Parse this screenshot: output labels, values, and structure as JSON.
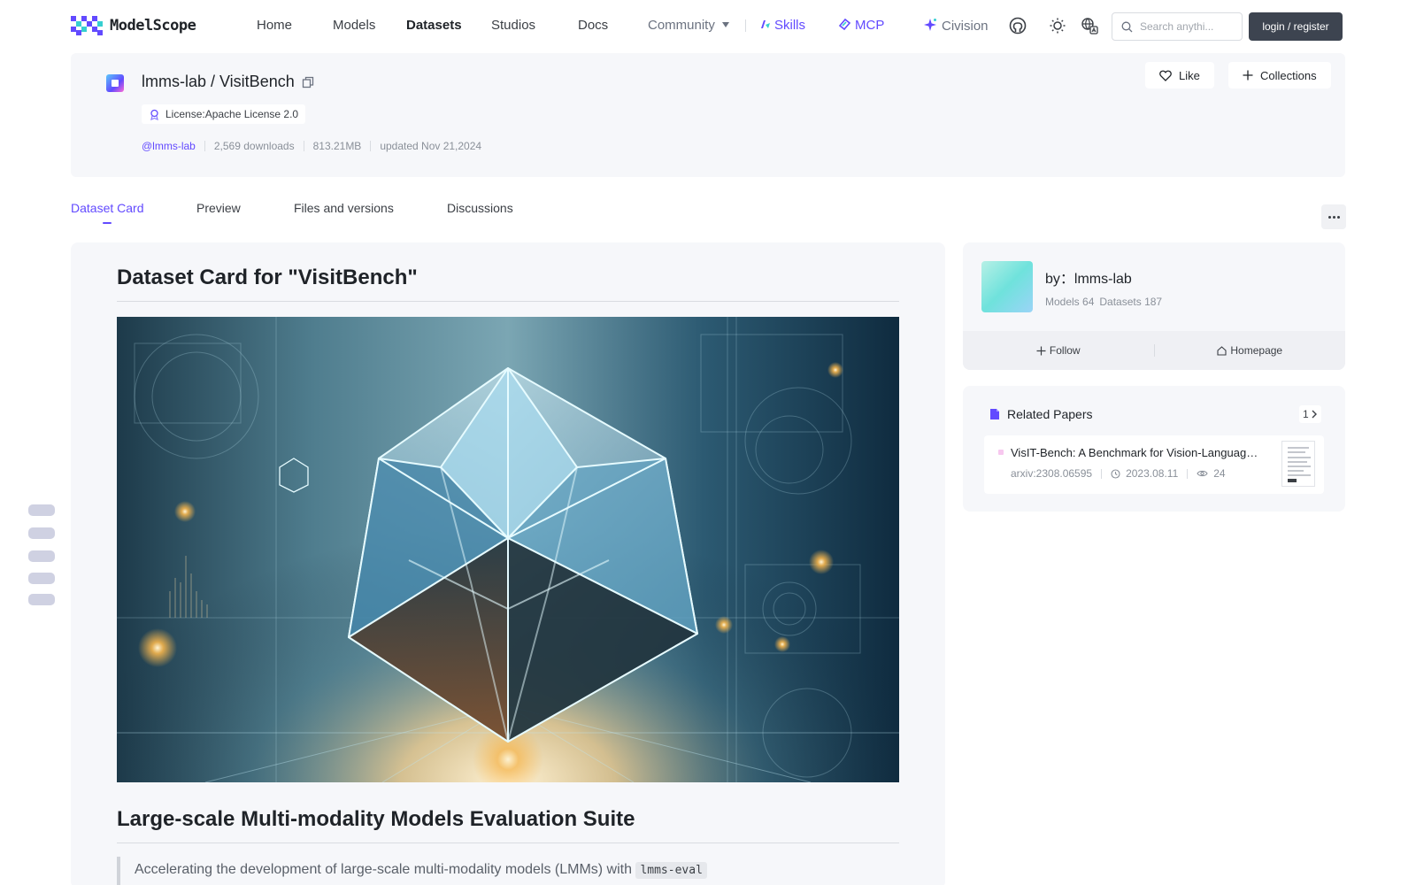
{
  "nav": {
    "logo_text": "ModelScope",
    "items": [
      "Home",
      "Models",
      "Datasets",
      "Studios",
      "Docs"
    ],
    "community": "Community",
    "skills": "Skills",
    "mcp": "MCP",
    "civision": "Civision",
    "search_placeholder": "Search anythi...",
    "login": "login / register",
    "accent": "#624aff"
  },
  "dataset": {
    "title": "lmms-lab / VisitBench",
    "license": "License:Apache License 2.0",
    "owner": "@lmms-lab",
    "downloads": "2,569 downloads",
    "size": "813.21MB",
    "updated": "updated Nov 21,2024",
    "like": "Like",
    "collections": "Collections"
  },
  "tabs": [
    "Dataset Card",
    "Preview",
    "Files and versions",
    "Discussions"
  ],
  "card": {
    "h1": "Dataset Card for \"VisitBench\"",
    "h2": "Large-scale Multi-modality Models Evaluation Suite",
    "quote": "Accelerating the development of large-scale multi-modality models (LMMs) with",
    "quote_code": "lmms-eval"
  },
  "owner": {
    "name": "by：lmms-lab",
    "models": "Models 64",
    "datasets": "Datasets 187",
    "follow": "Follow",
    "homepage": "Homepage"
  },
  "papers": {
    "title": "Related Papers",
    "count": "1",
    "items": [
      {
        "title": "VisIT-Bench: A Benchmark for Vision-Language Instruction Following Inspired by Real-World Use",
        "arxiv": "arxiv:2308.06595",
        "date": "2023.08.11",
        "views": "24"
      }
    ]
  }
}
